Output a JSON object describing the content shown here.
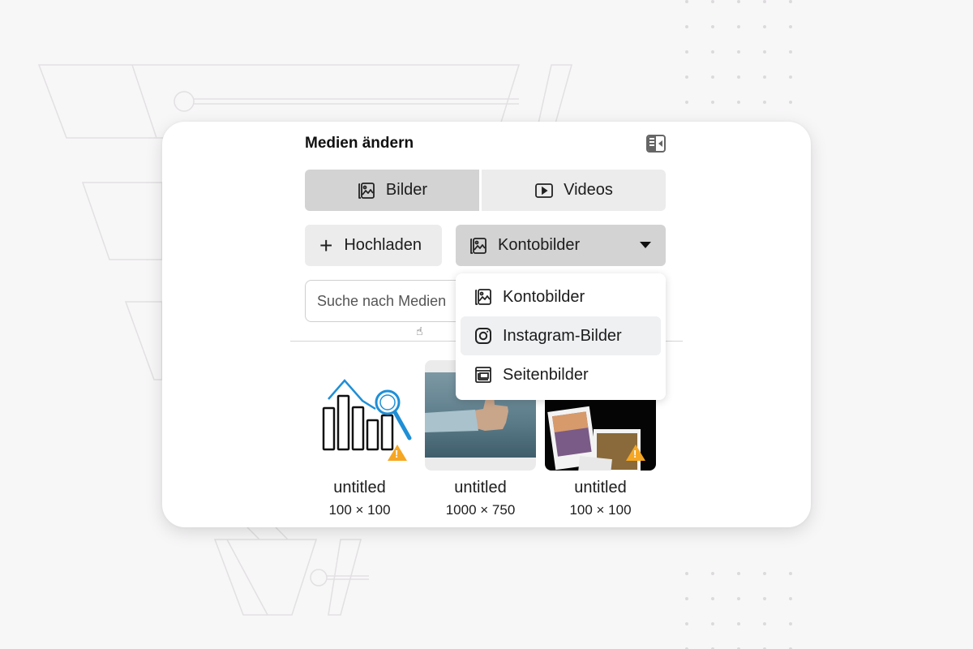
{
  "dialog": {
    "title": "Medien ändern",
    "panel_toggle_icon": "panel-collapse-icon"
  },
  "tabs": [
    {
      "label": "Bilder",
      "icon": "images-icon",
      "selected": true
    },
    {
      "label": "Videos",
      "icon": "play-icon",
      "selected": false
    }
  ],
  "toolbar": {
    "upload_label": "Hochladen",
    "upload_icon": "plus-icon",
    "source_dropdown": {
      "selected": "Kontobilder",
      "icon": "images-icon",
      "expanded": true
    }
  },
  "search": {
    "placeholder": "Suche nach Medien",
    "value": ""
  },
  "dropdown_menu": {
    "items": [
      {
        "label": "Kontobilder",
        "icon": "images-icon",
        "hovered": false
      },
      {
        "label": "Instagram-Bilder",
        "icon": "instagram-icon",
        "hovered": true
      },
      {
        "label": "Seitenbilder",
        "icon": "page-layout-icon",
        "hovered": false
      }
    ]
  },
  "media": [
    {
      "name": "untitled",
      "dims": "100 × 100",
      "thumbnail": "chart-magnifier-illustration",
      "warning": true
    },
    {
      "name": "untitled",
      "dims": "1000 × 750",
      "thumbnail": "thumbs-up-photo",
      "warning": false
    },
    {
      "name": "untitled",
      "dims": "100 × 100",
      "thumbnail": "photo-collage",
      "warning": true
    }
  ],
  "colors": {
    "selected_tab_bg": "#d3d3d3",
    "button_bg": "#ececec",
    "warning": "#f5a623",
    "accent_blue": "#1f8fd6"
  }
}
